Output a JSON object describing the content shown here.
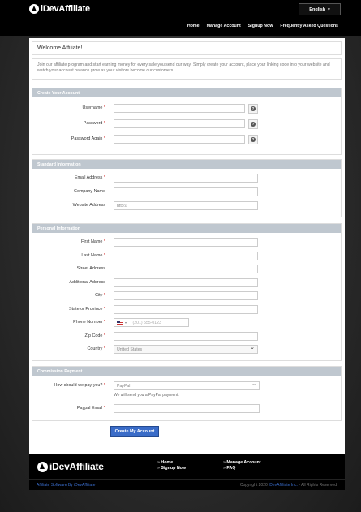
{
  "header": {
    "brand": "iDevAffiliate",
    "language": "English",
    "nav": [
      "Home",
      "Manage Account",
      "Signup Now",
      "Frequently Asked Questions"
    ]
  },
  "welcome": {
    "title": "Welcome Affiliate!",
    "intro": "Join our affiliate program and start earning money for every sale you send our way! Simply create your account, place your linking code into your website and watch your account balance grow as your visitors become our customers."
  },
  "create_account": {
    "heading": "Create Your Account",
    "username_label": "Username",
    "password_label": "Password",
    "password_again_label": "Password Again",
    "help_glyph": "?"
  },
  "standard": {
    "heading": "Standard Information",
    "email_label": "Email Address",
    "company_label": "Company Name",
    "website_label": "Website Address",
    "website_value": "http://"
  },
  "personal": {
    "heading": "Personal Information",
    "first_name_label": "First Name",
    "last_name_label": "Last Name",
    "street_label": "Street Address",
    "additional_label": "Additional Address",
    "city_label": "City",
    "state_label": "State or Province",
    "phone_label": "Phone Number",
    "phone_placeholder": "(201) 555-0123",
    "zip_label": "Zip Code",
    "country_label": "Country",
    "country_value": "United States"
  },
  "commission": {
    "heading": "Commission Payment",
    "pay_label": "How should we pay you?",
    "pay_value": "PayPal",
    "pay_hint": "We will send you a PayPal payment.",
    "paypal_email_label": "Paypal Email"
  },
  "form": {
    "required_mark": "*",
    "submit_label": "Create My Account"
  },
  "footer": {
    "brand": "iDevAffiliate",
    "links_col1": [
      "Home",
      "Signup Now"
    ],
    "links_col2": [
      "Manage Account",
      "FAQ"
    ],
    "powered": "Affiliate Software By iDevAffiliate",
    "copyright_prefix": "Copyright 2020",
    "copyright_brand": "iDevAffiliate Inc.",
    "copyright_suffix": "- All Rights Reserved"
  }
}
